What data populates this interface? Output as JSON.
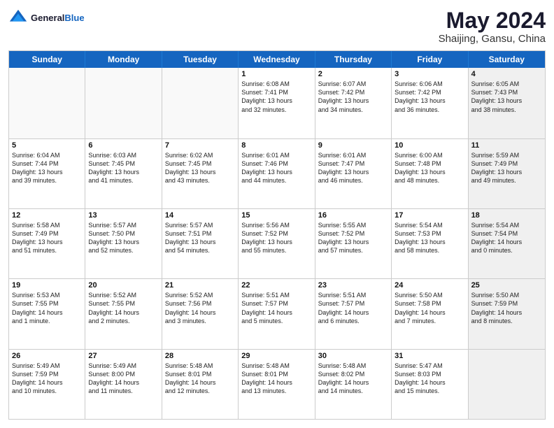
{
  "header": {
    "logo_general": "General",
    "logo_blue": "Blue",
    "month_title": "May 2024",
    "location": "Shaijing, Gansu, China"
  },
  "weekdays": [
    "Sunday",
    "Monday",
    "Tuesday",
    "Wednesday",
    "Thursday",
    "Friday",
    "Saturday"
  ],
  "rows": [
    [
      {
        "day": "",
        "text": "",
        "empty": true
      },
      {
        "day": "",
        "text": "",
        "empty": true
      },
      {
        "day": "",
        "text": "",
        "empty": true
      },
      {
        "day": "1",
        "text": "Sunrise: 6:08 AM\nSunset: 7:41 PM\nDaylight: 13 hours\nand 32 minutes."
      },
      {
        "day": "2",
        "text": "Sunrise: 6:07 AM\nSunset: 7:42 PM\nDaylight: 13 hours\nand 34 minutes."
      },
      {
        "day": "3",
        "text": "Sunrise: 6:06 AM\nSunset: 7:42 PM\nDaylight: 13 hours\nand 36 minutes."
      },
      {
        "day": "4",
        "text": "Sunrise: 6:05 AM\nSunset: 7:43 PM\nDaylight: 13 hours\nand 38 minutes.",
        "shaded": true
      }
    ],
    [
      {
        "day": "5",
        "text": "Sunrise: 6:04 AM\nSunset: 7:44 PM\nDaylight: 13 hours\nand 39 minutes."
      },
      {
        "day": "6",
        "text": "Sunrise: 6:03 AM\nSunset: 7:45 PM\nDaylight: 13 hours\nand 41 minutes."
      },
      {
        "day": "7",
        "text": "Sunrise: 6:02 AM\nSunset: 7:45 PM\nDaylight: 13 hours\nand 43 minutes."
      },
      {
        "day": "8",
        "text": "Sunrise: 6:01 AM\nSunset: 7:46 PM\nDaylight: 13 hours\nand 44 minutes."
      },
      {
        "day": "9",
        "text": "Sunrise: 6:01 AM\nSunset: 7:47 PM\nDaylight: 13 hours\nand 46 minutes."
      },
      {
        "day": "10",
        "text": "Sunrise: 6:00 AM\nSunset: 7:48 PM\nDaylight: 13 hours\nand 48 minutes."
      },
      {
        "day": "11",
        "text": "Sunrise: 5:59 AM\nSunset: 7:49 PM\nDaylight: 13 hours\nand 49 minutes.",
        "shaded": true
      }
    ],
    [
      {
        "day": "12",
        "text": "Sunrise: 5:58 AM\nSunset: 7:49 PM\nDaylight: 13 hours\nand 51 minutes."
      },
      {
        "day": "13",
        "text": "Sunrise: 5:57 AM\nSunset: 7:50 PM\nDaylight: 13 hours\nand 52 minutes."
      },
      {
        "day": "14",
        "text": "Sunrise: 5:57 AM\nSunset: 7:51 PM\nDaylight: 13 hours\nand 54 minutes."
      },
      {
        "day": "15",
        "text": "Sunrise: 5:56 AM\nSunset: 7:52 PM\nDaylight: 13 hours\nand 55 minutes."
      },
      {
        "day": "16",
        "text": "Sunrise: 5:55 AM\nSunset: 7:52 PM\nDaylight: 13 hours\nand 57 minutes."
      },
      {
        "day": "17",
        "text": "Sunrise: 5:54 AM\nSunset: 7:53 PM\nDaylight: 13 hours\nand 58 minutes."
      },
      {
        "day": "18",
        "text": "Sunrise: 5:54 AM\nSunset: 7:54 PM\nDaylight: 14 hours\nand 0 minutes.",
        "shaded": true
      }
    ],
    [
      {
        "day": "19",
        "text": "Sunrise: 5:53 AM\nSunset: 7:55 PM\nDaylight: 14 hours\nand 1 minute."
      },
      {
        "day": "20",
        "text": "Sunrise: 5:52 AM\nSunset: 7:55 PM\nDaylight: 14 hours\nand 2 minutes."
      },
      {
        "day": "21",
        "text": "Sunrise: 5:52 AM\nSunset: 7:56 PM\nDaylight: 14 hours\nand 3 minutes."
      },
      {
        "day": "22",
        "text": "Sunrise: 5:51 AM\nSunset: 7:57 PM\nDaylight: 14 hours\nand 5 minutes."
      },
      {
        "day": "23",
        "text": "Sunrise: 5:51 AM\nSunset: 7:57 PM\nDaylight: 14 hours\nand 6 minutes."
      },
      {
        "day": "24",
        "text": "Sunrise: 5:50 AM\nSunset: 7:58 PM\nDaylight: 14 hours\nand 7 minutes."
      },
      {
        "day": "25",
        "text": "Sunrise: 5:50 AM\nSunset: 7:59 PM\nDaylight: 14 hours\nand 8 minutes.",
        "shaded": true
      }
    ],
    [
      {
        "day": "26",
        "text": "Sunrise: 5:49 AM\nSunset: 7:59 PM\nDaylight: 14 hours\nand 10 minutes."
      },
      {
        "day": "27",
        "text": "Sunrise: 5:49 AM\nSunset: 8:00 PM\nDaylight: 14 hours\nand 11 minutes."
      },
      {
        "day": "28",
        "text": "Sunrise: 5:48 AM\nSunset: 8:01 PM\nDaylight: 14 hours\nand 12 minutes."
      },
      {
        "day": "29",
        "text": "Sunrise: 5:48 AM\nSunset: 8:01 PM\nDaylight: 14 hours\nand 13 minutes."
      },
      {
        "day": "30",
        "text": "Sunrise: 5:48 AM\nSunset: 8:02 PM\nDaylight: 14 hours\nand 14 minutes."
      },
      {
        "day": "31",
        "text": "Sunrise: 5:47 AM\nSunset: 8:03 PM\nDaylight: 14 hours\nand 15 minutes."
      },
      {
        "day": "",
        "text": "",
        "empty": true,
        "shaded": true
      }
    ]
  ]
}
